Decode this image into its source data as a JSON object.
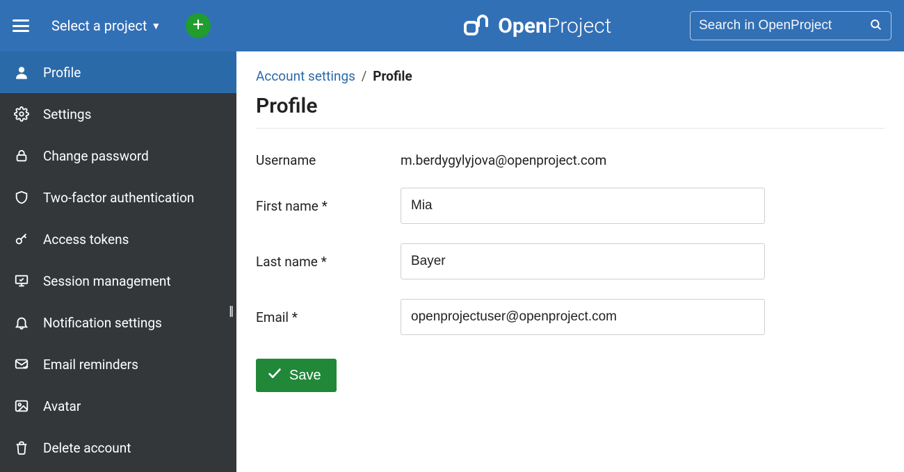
{
  "header": {
    "project_selector": "Select a project",
    "brand_bold": "Open",
    "brand_light": "Project",
    "search_placeholder": "Search in OpenProject"
  },
  "sidebar": {
    "items": [
      {
        "label": "Profile"
      },
      {
        "label": "Settings"
      },
      {
        "label": "Change password"
      },
      {
        "label": "Two-factor authentication"
      },
      {
        "label": "Access tokens"
      },
      {
        "label": "Session management"
      },
      {
        "label": "Notification settings"
      },
      {
        "label": "Email reminders"
      },
      {
        "label": "Avatar"
      },
      {
        "label": "Delete account"
      }
    ]
  },
  "breadcrumb": {
    "parent": "Account settings",
    "separator": "/",
    "current": "Profile"
  },
  "page": {
    "title": "Profile"
  },
  "form": {
    "username_label": "Username",
    "username_value": "m.berdygylyjova@openproject.com",
    "firstname_label": "First name *",
    "firstname_value": "Mia",
    "lastname_label": "Last name *",
    "lastname_value": "Bayer",
    "email_label": "Email *",
    "email_value": "openprojectuser@openproject.com",
    "save_label": "Save"
  }
}
